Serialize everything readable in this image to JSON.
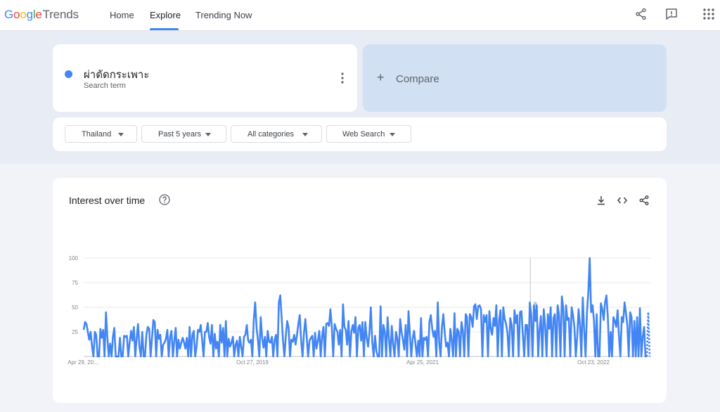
{
  "header": {
    "logo_google": "Google",
    "logo_trends": "Trends",
    "nav": [
      {
        "label": "Home"
      },
      {
        "label": "Explore"
      },
      {
        "label": "Trending Now"
      }
    ],
    "icons": [
      "share-icon",
      "feedback-icon",
      "apps-grid-icon"
    ]
  },
  "search": {
    "term": "ผ่าตัดกระเพาะ",
    "term_type": "Search term",
    "term_color": "#4285f4",
    "compare_label": "Compare"
  },
  "filters": [
    {
      "label": "Thailand"
    },
    {
      "label": "Past 5 years"
    },
    {
      "label": "All categories"
    },
    {
      "label": "Web Search"
    }
  ],
  "chart_card": {
    "title": "Interest over time",
    "note_label": "Note"
  },
  "chart_data": {
    "type": "line",
    "title": "Interest over time",
    "xlabel": "",
    "ylabel": "",
    "ylim": [
      0,
      100
    ],
    "yticks": [
      25,
      50,
      75,
      100
    ],
    "xtick_labels": [
      "Apr 29, 20...",
      "Oct 27, 2019",
      "Apr 25, 2021",
      "Oct 23, 2022"
    ],
    "grid": true,
    "series_color": "#4285f4",
    "series": [
      {
        "name": "ผ่าตัดกระเพาะ",
        "values": [
          27,
          35,
          33,
          25,
          17,
          25,
          10,
          0,
          25,
          22,
          0,
          0,
          28,
          19,
          27,
          0,
          45,
          19,
          0,
          13,
          0,
          20,
          29,
          0,
          0,
          0,
          19,
          0,
          0,
          21,
          20,
          21,
          0,
          14,
          26,
          16,
          30,
          0,
          18,
          33,
          10,
          0,
          25,
          0,
          0,
          22,
          30,
          28,
          0,
          19,
          37,
          35,
          0,
          27,
          18,
          22,
          0,
          12,
          14,
          18,
          27,
          0,
          20,
          26,
          0,
          16,
          29,
          0,
          17,
          8,
          14,
          19,
          14,
          8,
          19,
          0,
          30,
          0,
          22,
          26,
          0,
          10,
          27,
          25,
          32,
          17,
          0,
          25,
          25,
          34,
          20,
          13,
          32,
          0,
          23,
          8,
          15,
          0,
          32,
          14,
          29,
          0,
          36,
          0,
          18,
          10,
          14,
          20,
          0,
          12,
          16,
          0,
          20,
          10,
          0,
          20,
          22,
          32,
          16,
          14,
          17,
          0,
          37,
          55,
          29,
          17,
          0,
          40,
          19,
          9,
          20,
          0,
          26,
          15,
          14,
          20,
          0,
          17,
          22,
          0,
          55,
          62,
          40,
          16,
          0,
          21,
          36,
          29,
          0,
          17,
          15,
          22,
          12,
          22,
          33,
          42,
          16,
          0,
          24,
          38,
          20,
          0,
          16,
          19,
          21,
          0,
          24,
          8,
          16,
          26,
          0,
          20,
          30,
          0,
          33,
          34,
          31,
          48,
          30,
          0,
          33,
          28,
          25,
          12,
          27,
          0,
          53,
          30,
          27,
          12,
          36,
          0,
          25,
          32,
          24,
          40,
          0,
          29,
          32,
          16,
          35,
          0,
          35,
          19,
          10,
          25,
          50,
          15,
          0,
          21,
          5,
          0,
          0,
          51,
          0,
          32,
          25,
          0,
          40,
          18,
          0,
          31,
          12,
          0,
          25,
          18,
          0,
          38,
          25,
          17,
          7,
          32,
          0,
          46,
          22,
          0,
          18,
          26,
          13,
          0,
          16,
          0,
          39,
          0,
          19,
          17,
          20,
          0,
          35,
          42,
          28,
          20,
          26,
          0,
          55,
          15,
          0,
          30,
          43,
          24,
          10,
          14,
          0,
          28,
          17,
          0,
          44,
          0,
          28,
          25,
          0,
          35,
          26,
          0,
          43,
          40,
          0,
          43,
          40,
          30,
          51,
          53,
          38,
          51,
          52,
          48,
          0,
          42,
          35,
          42,
          0,
          46,
          28,
          22,
          39,
          31,
          52,
          0,
          37,
          47,
          0,
          50,
          38,
          33,
          24,
          0,
          39,
          32,
          0,
          47,
          34,
          42,
          0,
          45,
          46,
          22,
          0,
          32,
          32,
          0,
          55,
          42,
          0,
          52,
          36,
          52,
          0,
          27,
          41,
          0,
          48,
          32,
          0,
          43,
          28,
          50,
          0,
          39,
          43,
          0,
          52,
          42,
          0,
          61,
          49,
          0,
          52,
          37,
          39,
          0,
          50,
          42,
          30,
          0,
          20,
          48,
          32,
          0,
          60,
          27,
          0,
          45,
          65,
          100,
          45,
          52,
          37,
          0,
          43,
          0,
          0,
          54,
          48,
          37,
          55,
          62,
          40,
          0,
          25,
          0,
          40,
          36,
          30,
          47,
          20,
          0,
          40,
          35,
          55,
          44,
          31,
          0,
          45,
          40,
          0,
          36,
          0,
          40,
          0,
          49,
          0,
          20,
          30,
          0,
          0
        ]
      }
    ],
    "partial_tail": [
      45,
      0
    ],
    "note_marker_x_fraction": 0.75
  }
}
